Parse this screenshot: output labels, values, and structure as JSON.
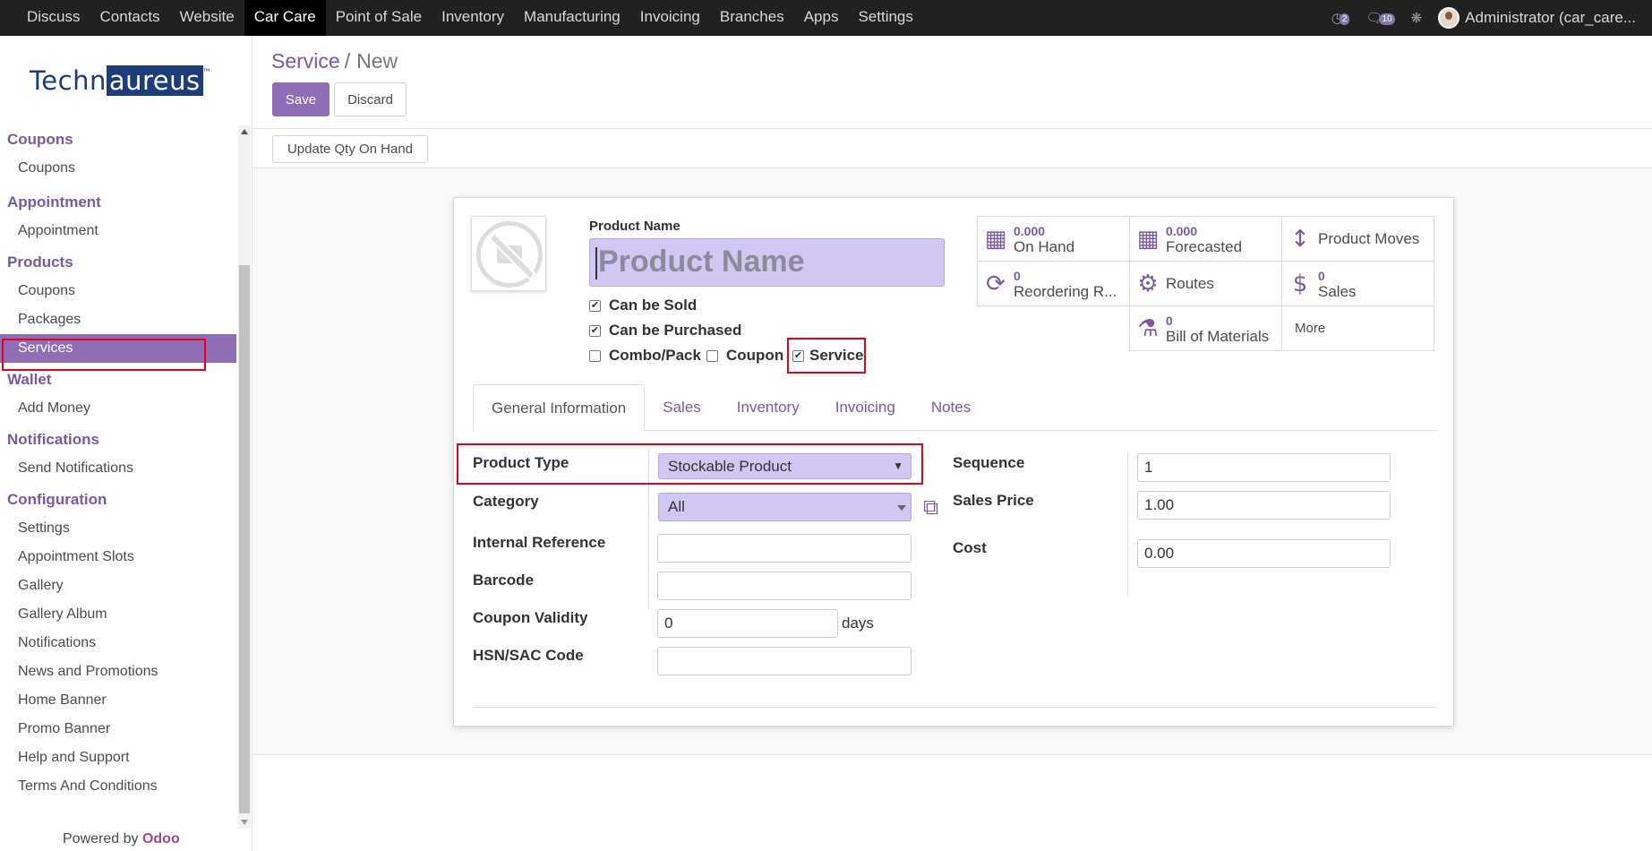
{
  "topbar": {
    "menu": [
      "Discuss",
      "Contacts",
      "Website",
      "Car Care",
      "Point of Sale",
      "Inventory",
      "Manufacturing",
      "Invoicing",
      "Branches",
      "Apps",
      "Settings"
    ],
    "active_menu": "Car Care",
    "activity_count": "2",
    "message_count": "10",
    "user": "Administrator (car_care..."
  },
  "logo": {
    "part1": "Techn",
    "part2": "aureus",
    "tm": "™"
  },
  "sidebar": {
    "sections": [
      {
        "title": "Coupons",
        "items": [
          "Coupons"
        ]
      },
      {
        "title": "Appointment",
        "items": [
          "Appointment"
        ]
      },
      {
        "title": "Products",
        "items": [
          "Coupons",
          "Packages",
          "Services"
        ]
      },
      {
        "title": "Wallet",
        "items": [
          "Add Money"
        ]
      },
      {
        "title": "Notifications",
        "items": [
          "Send Notifications"
        ]
      },
      {
        "title": "Configuration",
        "items": [
          "Settings",
          "Appointment Slots",
          "Gallery",
          "Gallery Album",
          "Notifications",
          "News and Promotions",
          "Home Banner",
          "Promo Banner",
          "Help and Support",
          "Terms And Conditions"
        ]
      }
    ],
    "active_item": "Services",
    "powered_by": "Powered by",
    "powered_brand": "Odoo"
  },
  "breadcrumb": {
    "parent": "Service",
    "separator": "/",
    "current": "New"
  },
  "buttons": {
    "save": "Save",
    "discard": "Discard",
    "update_qty": "Update Qty On Hand"
  },
  "form": {
    "product_name_label": "Product Name",
    "product_name_placeholder": "Product Name",
    "checkboxes": {
      "can_be_sold": {
        "label": "Can be Sold",
        "checked": true
      },
      "can_be_purchased": {
        "label": "Can be Purchased",
        "checked": true
      },
      "combo_pack": {
        "label": "Combo/Pack",
        "checked": false
      },
      "coupon": {
        "label": "Coupon",
        "checked": false
      },
      "service": {
        "label": "Service",
        "checked": true
      }
    },
    "smart_buttons": {
      "on_hand": {
        "value": "0.000",
        "label": "On Hand",
        "icon": "building-icon"
      },
      "forecasted": {
        "value": "0.000",
        "label": "Forecasted",
        "icon": "building-icon"
      },
      "product_moves": {
        "label": "Product Moves",
        "icon": "arrows-v-icon"
      },
      "reordering": {
        "value": "0",
        "label": "Reordering R...",
        "icon": "refresh-icon"
      },
      "routes": {
        "label": "Routes",
        "icon": "cogs-icon"
      },
      "sales": {
        "value": "0",
        "label": "Sales",
        "icon": "dollar-icon"
      },
      "bom": {
        "value": "0",
        "label": "Bill of Materials",
        "icon": "flask-icon"
      },
      "more": "More"
    },
    "tabs": [
      "General Information",
      "Sales",
      "Inventory",
      "Invoicing",
      "Notes"
    ],
    "active_tab": "General Information",
    "fields": {
      "product_type": {
        "label": "Product Type",
        "value": "Stockable Product"
      },
      "category": {
        "label": "Category",
        "value": "All"
      },
      "internal_reference": {
        "label": "Internal Reference",
        "value": ""
      },
      "barcode": {
        "label": "Barcode",
        "value": ""
      },
      "coupon_validity": {
        "label": "Coupon Validity",
        "value": "0",
        "unit": "days"
      },
      "hsn_sac": {
        "label": "HSN/SAC Code",
        "value": ""
      },
      "sequence": {
        "label": "Sequence",
        "value": "1"
      },
      "sales_price": {
        "label": "Sales Price",
        "value": "1.00"
      },
      "cost": {
        "label": "Cost",
        "value": "0.00"
      }
    }
  },
  "colors": {
    "brand": "#7c58a4",
    "active_bg": "#8e6fb5",
    "highlight": "#e8001c",
    "required_bg": "#d2c6f3"
  }
}
